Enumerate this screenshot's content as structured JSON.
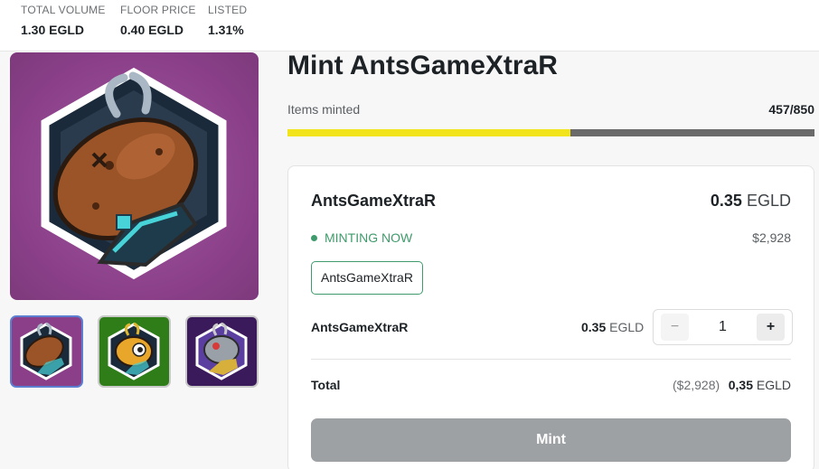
{
  "stats": {
    "total_volume": {
      "label": "TOTAL VOLUME",
      "value": "1.30 EGLD"
    },
    "floor_price": {
      "label": "FLOOR PRICE",
      "value": "0.40 EGLD"
    },
    "listed": {
      "label": "LISTED",
      "value": "1.31%"
    }
  },
  "gallery": {
    "main_image_icon": "ant-mascot-brown",
    "thumbnails": [
      {
        "icon": "ant-mascot-brown",
        "background": "#8a3f88",
        "selected": true
      },
      {
        "icon": "ant-mascot-yellow",
        "background": "#2f7d18",
        "selected": false
      },
      {
        "icon": "ant-mascot-armored",
        "background": "#3a1a5a",
        "selected": false
      }
    ]
  },
  "mint": {
    "title": "Mint AntsGameXtraR",
    "items_minted_label": "Items minted",
    "items_minted_count": "457/850",
    "progress_fraction": 0.5376
  },
  "card": {
    "collection_name": "AntsGameXtraR",
    "price_value": "0.35",
    "price_currency": "EGLD",
    "status": "MINTING NOW",
    "price_usd": "$2,928",
    "chip_label": "AntsGameXtraR",
    "row": {
      "name": "AntsGameXtraR",
      "price_value": "0.35",
      "price_currency": "EGLD"
    },
    "stepper": {
      "minus": "−",
      "value": "1",
      "plus": "+"
    },
    "total": {
      "label": "Total",
      "usd": "($2,928)",
      "value": "0,35",
      "currency": "EGLD"
    },
    "mint_button_label": "Mint"
  },
  "colors": {
    "accent_green": "#3f9b6b",
    "progress_fill": "#f2e41b",
    "progress_track": "#6a6a6a",
    "mint_button_disabled": "#9ea1a4",
    "thumb_selected_border": "#5c7fd1"
  }
}
